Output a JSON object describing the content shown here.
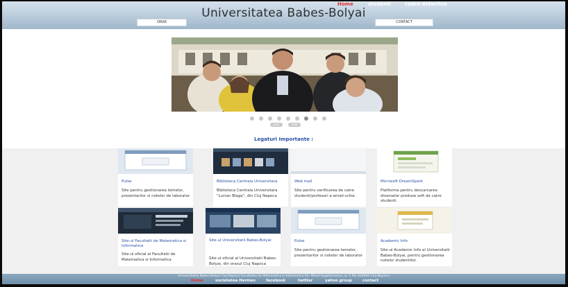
{
  "header": {
    "title": "Universitatea Babes-Bolyai",
    "nav": [
      "Home",
      "studenti",
      "cadre didactice"
    ],
    "orar_label": "ORAR",
    "contact_label": "CONTACT"
  },
  "slider": {
    "dots_count": 9,
    "active_dot": 6,
    "prev_label": "prev",
    "next_label": "next"
  },
  "section_title": "Legaturi Importante :",
  "cards": [
    {
      "title": "Pulse",
      "desc": "Site pentru gestionarea temelor, prezentarilor si notelor de laborator"
    },
    {
      "title": "Biblioteca Centrala Universitara",
      "desc": "Biblioteca Centrala Universitara \"Lucian Blaga\", din Cluj Napoca"
    },
    {
      "title": "Web mail",
      "desc": "Site pentru verificarea de catre studenti/profesori a email-urilor."
    },
    {
      "title": "Microsoft DreamSpark",
      "desc": "Platforma pentru descarcarea diverselor produse soft de catre studenti."
    },
    {
      "title": "Site-ul Facultatii de Matematica si Informatica",
      "desc": "Site-ul oficial al Facultatii de Matematica si Informatica"
    },
    {
      "title": "Site-ul Universitatii Babes-Bolyai",
      "desc": "Site-ul oficial al Universitatii Babes-Bolyai, din orasul Cluj Napoca"
    },
    {
      "title": "Pulse",
      "desc": "Site pentru gestionarea temelor, prezentarilor si notelor de laborator"
    },
    {
      "title": "Academic Info",
      "desc": "Site-ul Academic Info al Universitatii Babes-Bolyai, pentru gestionarea notelor studentilor."
    }
  ],
  "footer": {
    "address": "Universitatea Babes-Bolyai Cluj-Napoca Facultatea de Matematica si Informatica Str. Mihail Kogalniceanu, nr. 1 RO-400084 Cluj-Napoca",
    "links": [
      "Home",
      "societatea Hermes",
      "facebook",
      "twitter",
      "yahoo group",
      "contact"
    ]
  },
  "colors": {
    "header_top": "#d6e2ec",
    "header_bottom": "#9fb7cb",
    "link_blue": "#2a4fa1",
    "active_red": "#e03030"
  }
}
